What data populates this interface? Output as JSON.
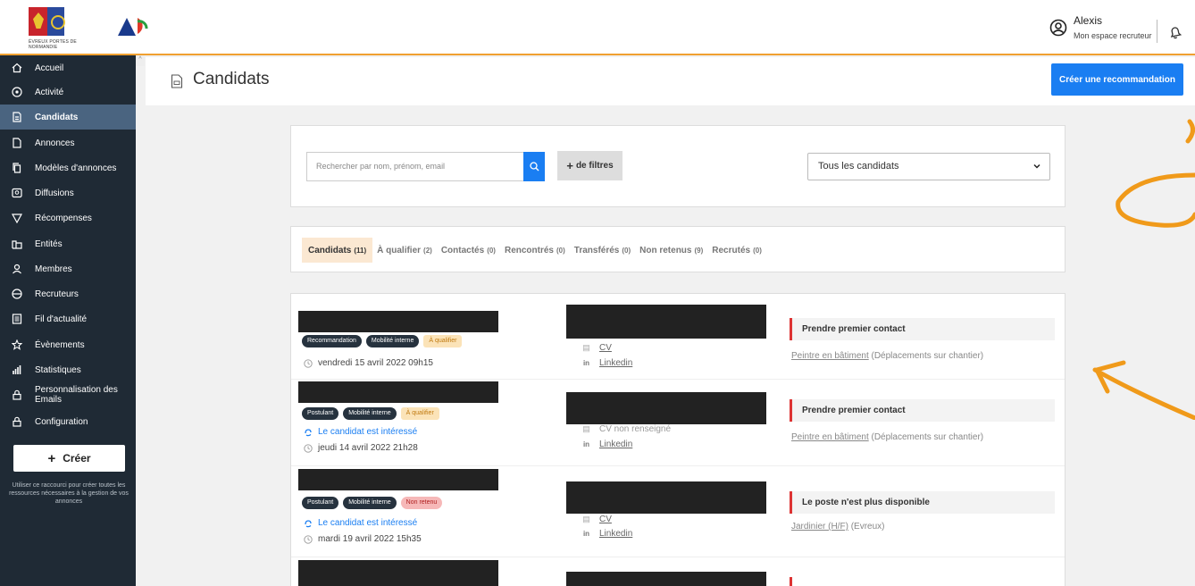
{
  "topbar": {
    "logo_city": "ÉVREUX PORTES DE NORMANDIE",
    "user_name": "Alexis",
    "user_role": "Mon espace recruteur",
    "icons": [
      "user-circle-icon",
      "bell-icon"
    ]
  },
  "sidebar": {
    "items": [
      {
        "label": "Accueil",
        "icon": "home-icon"
      },
      {
        "label": "Activité",
        "icon": "activity-icon"
      },
      {
        "label": "Candidats",
        "icon": "document-icon",
        "active": true
      },
      {
        "label": "Annonces",
        "icon": "file-icon"
      },
      {
        "label": "Modèles d'annonces",
        "icon": "copy-icon"
      },
      {
        "label": "Diffusions",
        "icon": "broadcast-icon"
      },
      {
        "label": "Récompenses",
        "icon": "reward-icon"
      },
      {
        "label": "Entités",
        "icon": "building-icon"
      },
      {
        "label": "Membres",
        "icon": "person-icon"
      },
      {
        "label": "Recruteurs",
        "icon": "recruiter-icon"
      },
      {
        "label": "Fil d'actualité",
        "icon": "news-icon"
      },
      {
        "label": "Évènements",
        "icon": "star-icon"
      },
      {
        "label": "Statistiques",
        "icon": "chart-icon"
      },
      {
        "label": "Personnalisation des Emails",
        "icon": "lock-icon"
      },
      {
        "label": "Configuration",
        "icon": "lock-icon"
      }
    ],
    "create_label": "Créer",
    "hint": "Utiliser ce raccourci pour créer toutes les ressources nécessaires à la gestion de vos annonces"
  },
  "header": {
    "title": "Candidats",
    "recommend_label": "Créer une recommandation"
  },
  "search": {
    "placeholder": "Rechercher par nom, prénom, email",
    "filters_label": "de filtres",
    "select_value": "Tous les candidats"
  },
  "tabs": [
    {
      "label": "Candidats",
      "count": "(11)",
      "active": true
    },
    {
      "label": "À qualifier",
      "count": "(2)"
    },
    {
      "label": "Contactés",
      "count": "(0)"
    },
    {
      "label": "Rencontrés",
      "count": "(0)"
    },
    {
      "label": "Transférés",
      "count": "(0)"
    },
    {
      "label": "Non retenus",
      "count": "(9)"
    },
    {
      "label": "Recrutés",
      "count": "(0)"
    }
  ],
  "candidates": [
    {
      "tags": [
        {
          "label": "Recommandation",
          "kind": "dark"
        },
        {
          "label": "Mobilité interne",
          "kind": "dark"
        },
        {
          "label": "À qualifier",
          "kind": "qual"
        }
      ],
      "interest": "",
      "date": "vendredi 15 avril 2022 09h15",
      "cv": "CV",
      "linkedin": "Linkedin",
      "action": "Prendre premier contact",
      "job": "Peintre en bâtiment",
      "job_place": "(Déplacements sur chantier)"
    },
    {
      "tags": [
        {
          "label": "Postulant",
          "kind": "dark"
        },
        {
          "label": "Mobilité interne",
          "kind": "dark"
        },
        {
          "label": "À qualifier",
          "kind": "qual"
        }
      ],
      "interest": "Le candidat est intéressé",
      "date": "jeudi 14 avril 2022 21h28",
      "cv": "CV non renseigné",
      "linkedin": "Linkedin",
      "action": "Prendre premier contact",
      "job": "Peintre en bâtiment",
      "job_place": "(Déplacements sur chantier)"
    },
    {
      "tags": [
        {
          "label": "Postulant",
          "kind": "dark"
        },
        {
          "label": "Mobilité interne",
          "kind": "dark"
        },
        {
          "label": "Non retenu",
          "kind": "rej"
        }
      ],
      "interest": "Le candidat est intéressé",
      "date": "mardi 19 avril 2022 15h35",
      "cv": "CV",
      "linkedin": "Linkedin",
      "action": "Le poste n'est plus disponible",
      "job": "Jardinier (H/F)",
      "job_place": "(Evreux)"
    }
  ],
  "colors": {
    "sidebar_bg": "#1f2a35",
    "sidebar_active": "#4a6480",
    "accent_blue": "#1a7ef2",
    "topbar_border": "#f0a030",
    "action_border": "#dd3333",
    "decoration_orange": "#f09a1a"
  }
}
